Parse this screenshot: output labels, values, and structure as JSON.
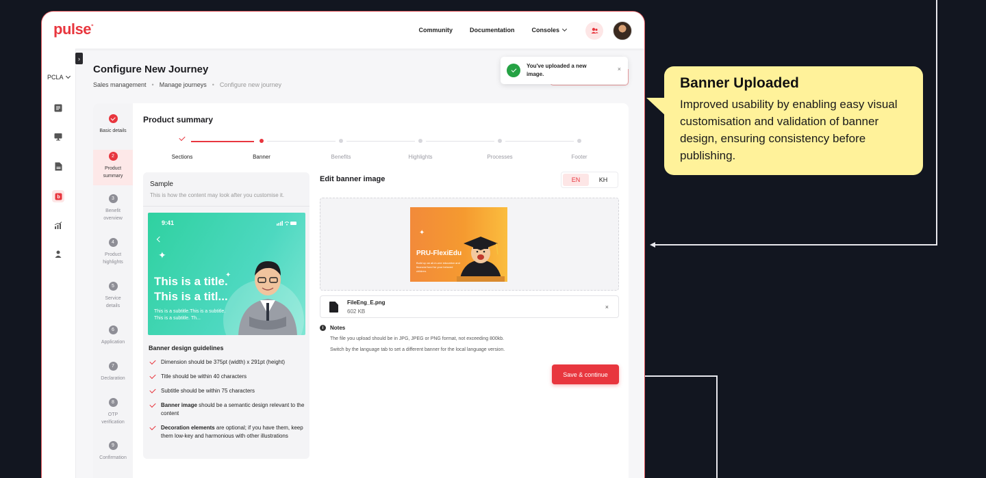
{
  "header": {
    "logo": "pulse",
    "nav": [
      "Community",
      "Documentation",
      "Consoles"
    ]
  },
  "rail": {
    "org": "PCLA"
  },
  "page": {
    "title": "Configure New Journey",
    "breadcrumb": [
      "Sales management",
      "Manage journeys",
      "Configure new journey"
    ]
  },
  "toast": {
    "message": "You've uploaded a new image.",
    "close": "×"
  },
  "steps": [
    {
      "num": "",
      "label": "Basic details",
      "state": "done"
    },
    {
      "num": "2",
      "label": "Product summary",
      "state": "active"
    },
    {
      "num": "3",
      "label": "Benefit overview",
      "state": "todo"
    },
    {
      "num": "4",
      "label": "Product highlights",
      "state": "todo"
    },
    {
      "num": "5",
      "label": "Service details",
      "state": "todo"
    },
    {
      "num": "6",
      "label": "Application",
      "state": "todo"
    },
    {
      "num": "7",
      "label": "Declaration",
      "state": "todo"
    },
    {
      "num": "8",
      "label": "OTP verification",
      "state": "todo"
    },
    {
      "num": "9",
      "label": "Confirmation",
      "state": "todo"
    }
  ],
  "section": {
    "title": "Product summary",
    "substeps": [
      "Sections",
      "Banner",
      "Benefits",
      "Highlights",
      "Processes",
      "Footer"
    ]
  },
  "sample": {
    "title": "Sample",
    "subtitle": "This is how the content may look after you customise it.",
    "phone_time": "9:41",
    "phone_title_1": "This is a title.",
    "phone_title_2": "This is a titl...",
    "phone_subtitle": "This is a subtitle.This is a subtitle. This is a subtitle. Th...",
    "guidelines_title": "Banner design guidelines"
  },
  "guidelines": [
    {
      "bold": "",
      "text": "Dimension should be 375pt (width) x 291pt (height)"
    },
    {
      "bold": "",
      "text": "Title should be within 40 characters"
    },
    {
      "bold": "",
      "text": "Subtitle should be within 75 characters"
    },
    {
      "bold": "Banner image",
      "text": " should be a semantic design relevant to the content"
    },
    {
      "bold": "Decoration elements",
      "text": " are optional; if you have them, keep them low-key and harmonious with other illustrations"
    }
  ],
  "editor": {
    "title": "Edit banner image",
    "languages": [
      "EN",
      "KH"
    ],
    "banner_brand": "PRU-FlexiEdu",
    "banner_copy": "Build up an all-in-one education and financial fund for your beloved children.",
    "file_name": "FileEng_E.png",
    "file_size": "602 KB",
    "file_close": "×",
    "notes_title": "Notes",
    "notes": [
      "The file you upload should be in JPG, JPEG or PNG format, not exceeding 800kb.",
      "Switch by the language tab to set a different banner for the local language version."
    ],
    "save_label": "Save & continue"
  },
  "callout": {
    "title": "Banner Uploaded",
    "body": "Improved usability by enabling easy visual customisation and validation of banner design, ensuring consistency before publishing."
  },
  "colors": {
    "brand": "#e8363e",
    "success": "#25a244",
    "callout": "#fff29a",
    "background": "#121620"
  }
}
